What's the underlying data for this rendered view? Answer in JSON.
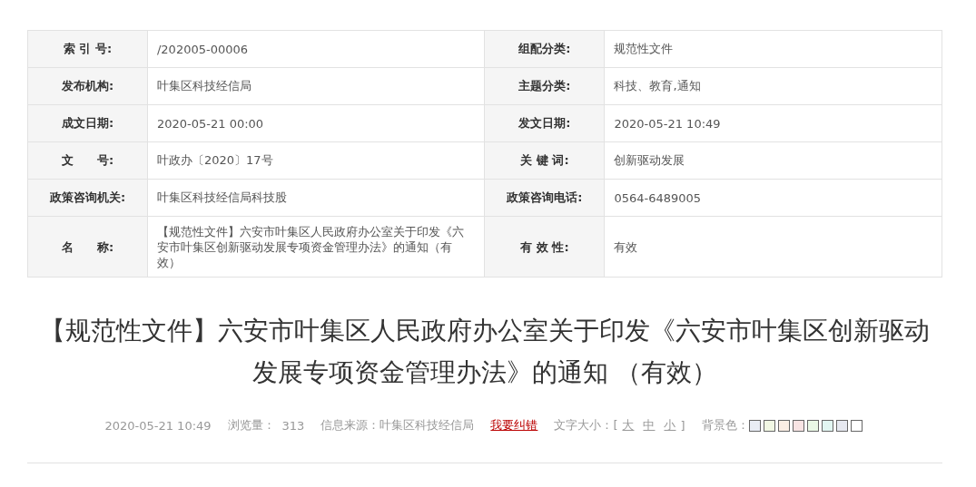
{
  "info_table": {
    "rows": [
      [
        {
          "label": "索 引 号:",
          "value": "/202005-00006"
        },
        {
          "label": "组配分类:",
          "value": "规范性文件"
        }
      ],
      [
        {
          "label": "发布机构:",
          "value": "叶集区科技经信局"
        },
        {
          "label": "主题分类:",
          "value": "科技、教育,通知"
        }
      ],
      [
        {
          "label": "成文日期:",
          "value": "2020-05-21 00:00"
        },
        {
          "label": "发文日期:",
          "value": "2020-05-21 10:49"
        }
      ],
      [
        {
          "label": "文　　号:",
          "value": "叶政办〔2020〕17号"
        },
        {
          "label": "关 键 词:",
          "value": "创新驱动发展"
        }
      ],
      [
        {
          "label": "政策咨询机关:",
          "value": "叶集区科技经信局科技股"
        },
        {
          "label": "政策咨询电话:",
          "value": "0564-6489005"
        }
      ],
      [
        {
          "label": "名　　称:",
          "value": "【规范性文件】六安市叶集区人民政府办公室关于印发《六安市叶集区创新驱动发展专项资金管理办法》的通知（有效）"
        },
        {
          "label": "有 效 性:",
          "value": "有效"
        }
      ]
    ]
  },
  "article": {
    "title": "【规范性文件】六安市叶集区人民政府办公室关于印发《六安市叶集区创新驱动发展专项资金管理办法》的通知 （有效）",
    "meta": {
      "date": "2020-05-21 10:49",
      "views_label": "浏览量：",
      "views": "313",
      "source": "信息来源：叶集区科技经信局",
      "correction_link": "我要纠错",
      "font_size_label": "文字大小：[",
      "font_sizes": [
        "大",
        "中",
        "小"
      ],
      "font_size_close": "]",
      "background_label": "背景色：",
      "background_swatches": [
        {
          "color": "#e8ecf4"
        },
        {
          "color": "#f2f8e4"
        },
        {
          "color": "#fbeee4"
        },
        {
          "color": "#f8e4e4"
        },
        {
          "color": "#eaf8e6"
        },
        {
          "color": "#e2f6f2"
        },
        {
          "color": "#e6e8f0"
        },
        {
          "color": "#ffffff"
        }
      ]
    }
  }
}
